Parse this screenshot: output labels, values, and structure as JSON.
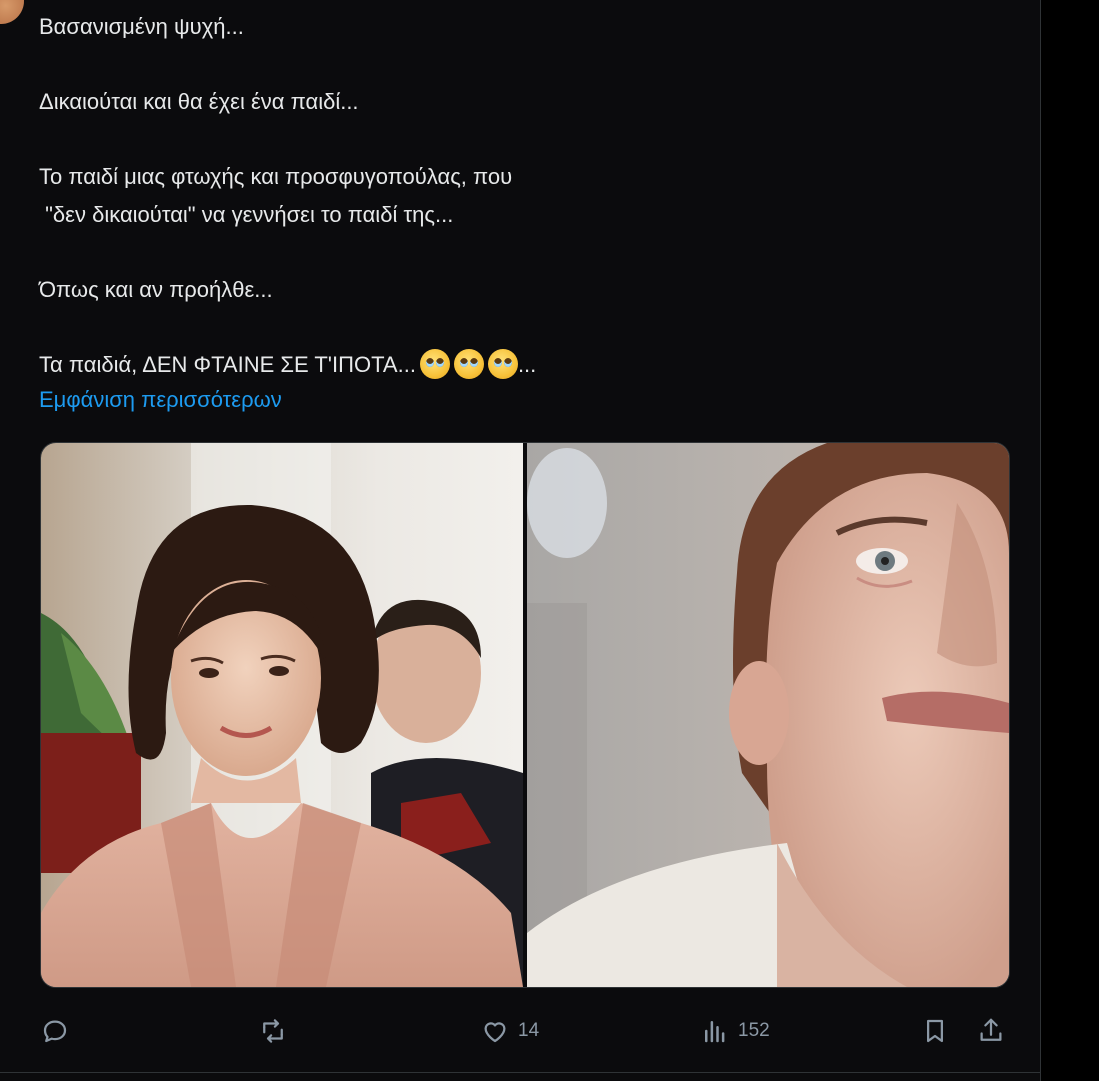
{
  "tweet": {
    "text_lines": [
      "Βασανισμένη ψυχή...",
      "",
      "Δικαιούται και θα έχει ένα παιδί...",
      "",
      "Το παιδί μιας φτωχής και προσφυγοπούλας, που",
      " \"δεν δικαιούται\" να γεννήσει το παιδί της...",
      "",
      "Όπως και αν προήλθε...",
      ""
    ],
    "last_line_text": "Τα παιδιά, ΔΕΝ ΦΤΑΙΝΕ ΣΕ Τ'ΙΠΟΤΑ...",
    "last_line_suffix": "...",
    "emojis": [
      "pleading-face-icon",
      "pleading-face-icon",
      "pleading-face-icon"
    ],
    "show_more_label": "Εμφάνιση περισσότερων"
  },
  "media": [
    {
      "name": "photo-woman-smiling",
      "description_icon": "photo-icon"
    },
    {
      "name": "photo-woman-tearful",
      "description_icon": "photo-icon"
    }
  ],
  "actions": {
    "reply": {
      "icon": "reply-icon",
      "count": ""
    },
    "repost": {
      "icon": "repost-icon",
      "count": ""
    },
    "like": {
      "icon": "heart-icon",
      "count": "14"
    },
    "views": {
      "icon": "views-icon",
      "count": "152"
    },
    "bookmark": {
      "icon": "bookmark-icon"
    },
    "share": {
      "icon": "share-icon"
    }
  },
  "colors": {
    "background": "#0b0b0d",
    "text": "#e7e9ea",
    "link": "#1d9bf0",
    "muted": "#8b98a5",
    "border": "#2f3336"
  }
}
